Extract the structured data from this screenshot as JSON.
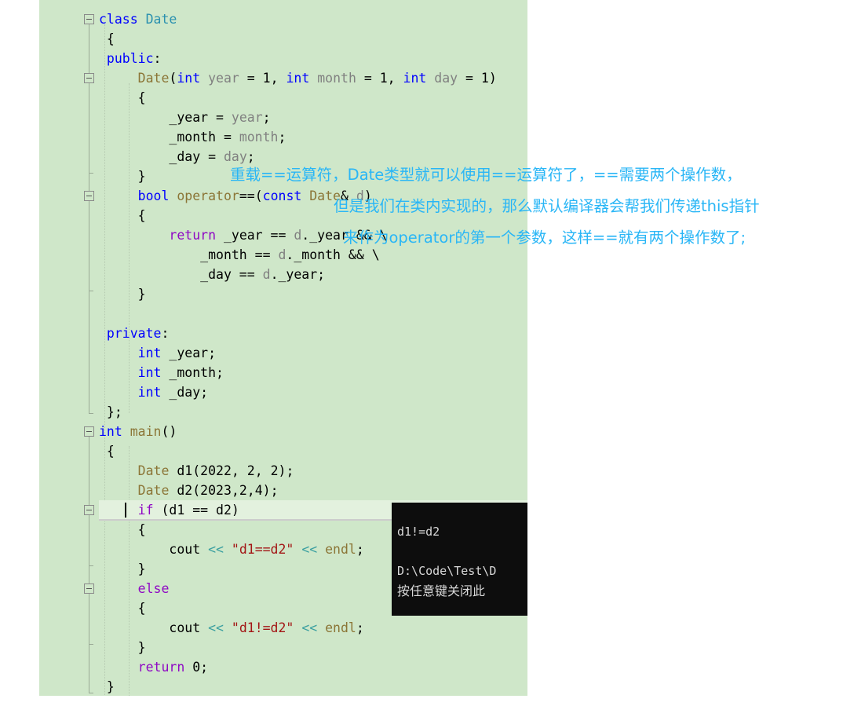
{
  "editor": {
    "background_color": "#cfe7c9",
    "change_bar_color": "#1c7a26",
    "current_line_color": "#e3f1de",
    "lines": [
      {
        "n": 0,
        "text": "",
        "partial": true
      },
      {
        "n": 1,
        "text": "class Date"
      },
      {
        "n": 2,
        "text": "{"
      },
      {
        "n": 3,
        "text": "public:"
      },
      {
        "n": 4,
        "text": "    Date(int year = 1, int month = 1, int day = 1)"
      },
      {
        "n": 5,
        "text": "    {"
      },
      {
        "n": 6,
        "text": "        _year = year;"
      },
      {
        "n": 7,
        "text": "        _month = month;"
      },
      {
        "n": 8,
        "text": "        _day = day;"
      },
      {
        "n": 9,
        "text": "    }"
      },
      {
        "n": 10,
        "text": "    bool operator==(const Date& d)"
      },
      {
        "n": 11,
        "text": "    {"
      },
      {
        "n": 12,
        "text": "        return _year == d._year && \\"
      },
      {
        "n": 13,
        "text": "            _month == d._month && \\"
      },
      {
        "n": 14,
        "text": "            _day == d._year;"
      },
      {
        "n": 15,
        "text": "    }"
      },
      {
        "n": 16,
        "text": ""
      },
      {
        "n": 17,
        "text": "private:"
      },
      {
        "n": 18,
        "text": "    int _year;"
      },
      {
        "n": 19,
        "text": "    int _month;"
      },
      {
        "n": 20,
        "text": "    int _day;"
      },
      {
        "n": 21,
        "text": "};"
      },
      {
        "n": 22,
        "text": "int main()"
      },
      {
        "n": 23,
        "text": "{"
      },
      {
        "n": 24,
        "text": "    Date d1(2022, 2, 2);"
      },
      {
        "n": 25,
        "text": "    Date d2(2023,2,4);"
      },
      {
        "n": 26,
        "text": "    if (d1 == d2)",
        "current": true
      },
      {
        "n": 27,
        "text": "    {"
      },
      {
        "n": 28,
        "text": "        cout << \"d1==d2\" << endl;"
      },
      {
        "n": 29,
        "text": "    }"
      },
      {
        "n": 30,
        "text": "    else"
      },
      {
        "n": 31,
        "text": "    {"
      },
      {
        "n": 32,
        "text": "        cout << \"d1!=d2\" << endl;"
      },
      {
        "n": 33,
        "text": "    }"
      },
      {
        "n": 34,
        "text": "    return 0;"
      },
      {
        "n": 35,
        "text": "}"
      }
    ]
  },
  "annotations": {
    "color": "#29b6f6",
    "line1": "重载==运算符，Date类型就可以使用==运算符了，==需要两个操作数，",
    "line2": "但是我们在类内实现的，那么默认编译器会帮我们传递this指针",
    "line3": "来作为operator的第一个参数，这样==就有两个操作数了;"
  },
  "console": {
    "background_color": "#0d0d0d",
    "output_line": "d1!=d2",
    "path_line": "D:\\Code\\Test\\D",
    "prompt_line": "按任意键关闭此"
  }
}
